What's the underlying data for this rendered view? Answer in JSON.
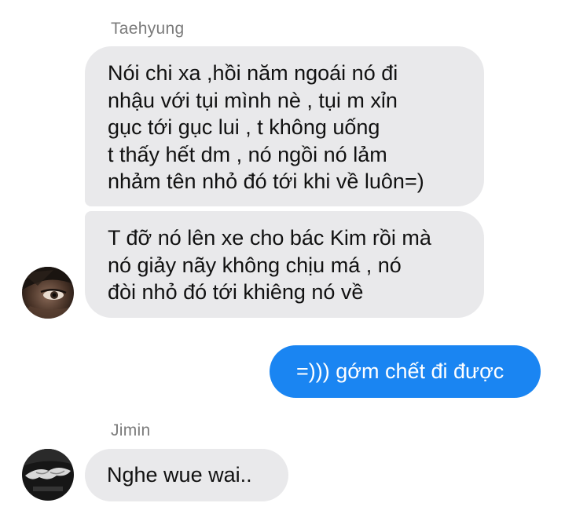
{
  "thread": {
    "groups": [
      {
        "sender": "Taehyung",
        "avatar_icon": "user-avatar-eye-photo",
        "messages": [
          "Nói chi xa ,hồi năm ngoái nó đi\nnhậu với tụi mình nè , tụi m xỉn\ngục tới gục lui , t không uống\nt thấy hết dm , nó ngồi nó lảm\nnhảm tên nhỏ đó tới khi về luôn=)",
          "T đỡ nó lên xe cho bác Kim rồi mà\nnó giảy nãy không chịu má , nó\nđòi nhỏ đó tới khiêng nó về"
        ]
      },
      {
        "sender": "me",
        "messages": [
          "=))) gớm chết đi được"
        ]
      },
      {
        "sender": "Jimin",
        "avatar_icon": "user-avatar-hands-photo",
        "messages": [
          "Nghe wue wai.."
        ]
      }
    ]
  },
  "colors": {
    "incoming_bubble": "#e9e9eb",
    "outgoing_bubble": "#1a85f2",
    "sender_name": "#7b7b7b"
  }
}
